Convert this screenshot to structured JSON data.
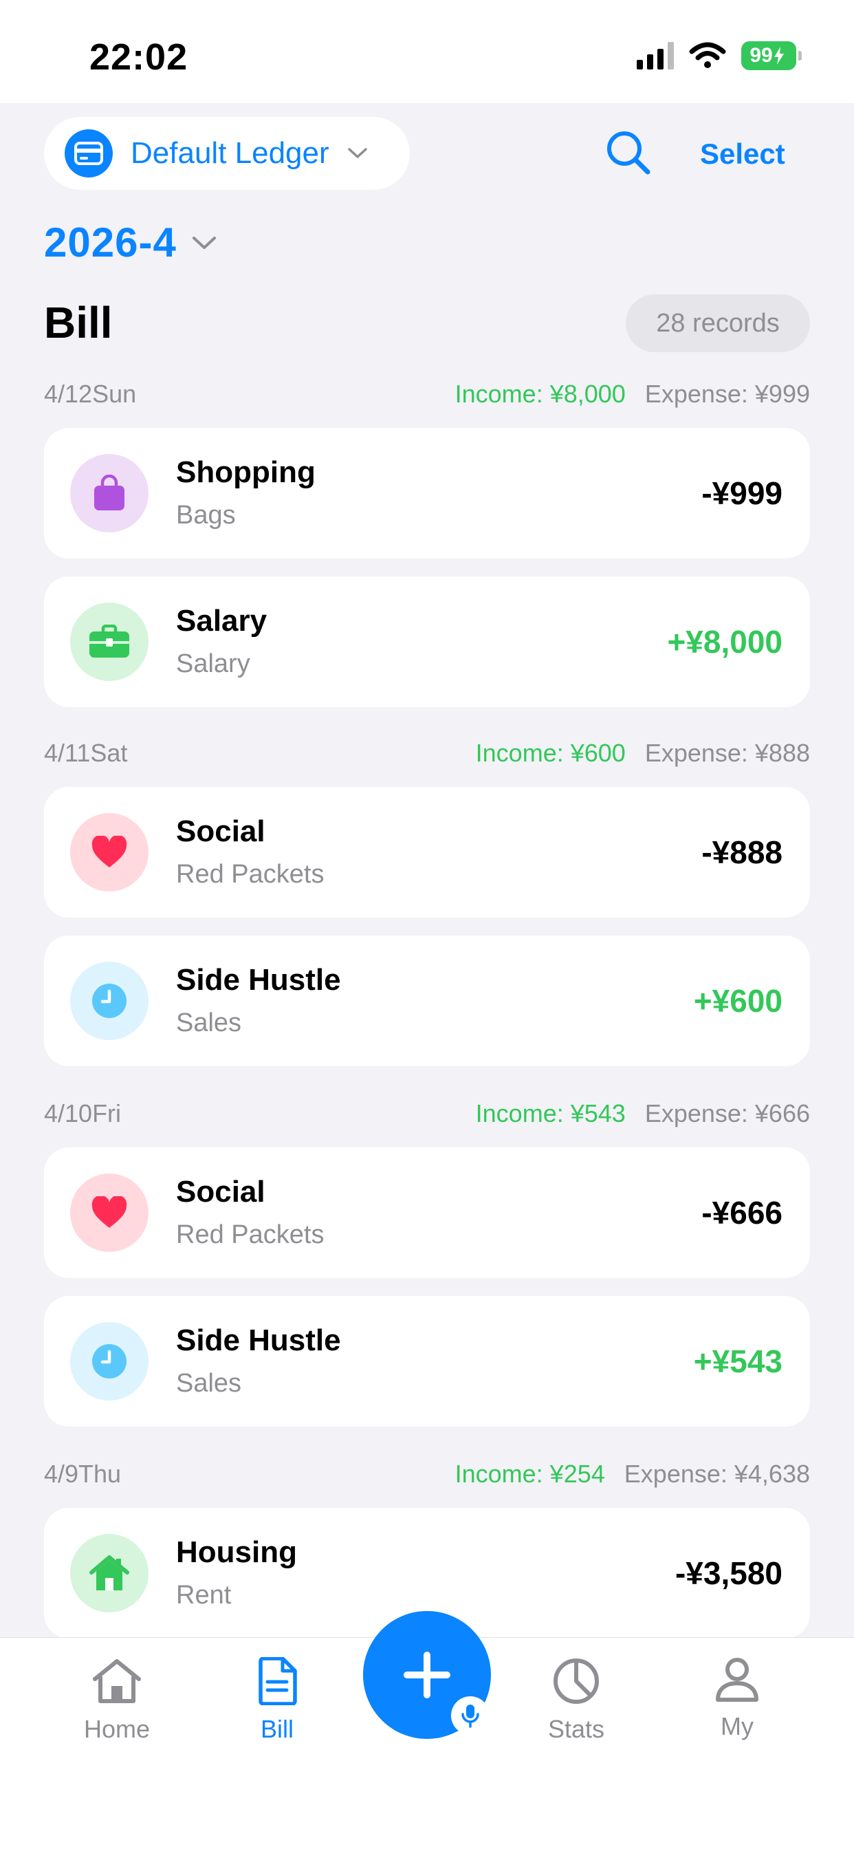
{
  "status_bar": {
    "time": "22:02",
    "battery": "99"
  },
  "header": {
    "ledger_name": "Default Ledger",
    "select_label": "Select",
    "month": "2026-4"
  },
  "bill": {
    "title": "Bill",
    "records": "28 records"
  },
  "groups": [
    {
      "date": "4/12Sun",
      "income": "Income: ¥8,000",
      "expense": "Expense: ¥999",
      "items": [
        {
          "category": "Shopping",
          "sub": "Bags",
          "amount": "-¥999",
          "icon": "bag-icon"
        },
        {
          "category": "Salary",
          "sub": "Salary",
          "amount": "+¥8,000",
          "icon": "briefcase-icon"
        }
      ]
    },
    {
      "date": "4/11Sat",
      "income": "Income: ¥600",
      "expense": "Expense: ¥888",
      "items": [
        {
          "category": "Social",
          "sub": "Red Packets",
          "amount": "-¥888",
          "icon": "heart-icon"
        },
        {
          "category": "Side Hustle",
          "sub": "Sales",
          "amount": "+¥600",
          "icon": "clock-icon"
        }
      ]
    },
    {
      "date": "4/10Fri",
      "income": "Income: ¥543",
      "expense": "Expense: ¥666",
      "items": [
        {
          "category": "Social",
          "sub": "Red Packets",
          "amount": "-¥666",
          "icon": "heart-icon"
        },
        {
          "category": "Side Hustle",
          "sub": "Sales",
          "amount": "+¥543",
          "icon": "clock-icon"
        }
      ]
    },
    {
      "date": "4/9Thu",
      "income": "Income: ¥254",
      "expense": "Expense: ¥4,638",
      "items": [
        {
          "category": "Housing",
          "sub": "Rent",
          "amount": "-¥3,580",
          "icon": "house-icon"
        }
      ]
    }
  ],
  "tabs": [
    {
      "label": "Home",
      "icon": "home-icon"
    },
    {
      "label": "Bill",
      "icon": "bill-icon"
    },
    {
      "label": "Stats",
      "icon": "pie-chart-icon"
    },
    {
      "label": "My",
      "icon": "person-icon"
    }
  ],
  "colors": {
    "accent": "#0a84ff",
    "income": "#34c759",
    "expense": "#000000",
    "background": "#f2f2f7"
  }
}
